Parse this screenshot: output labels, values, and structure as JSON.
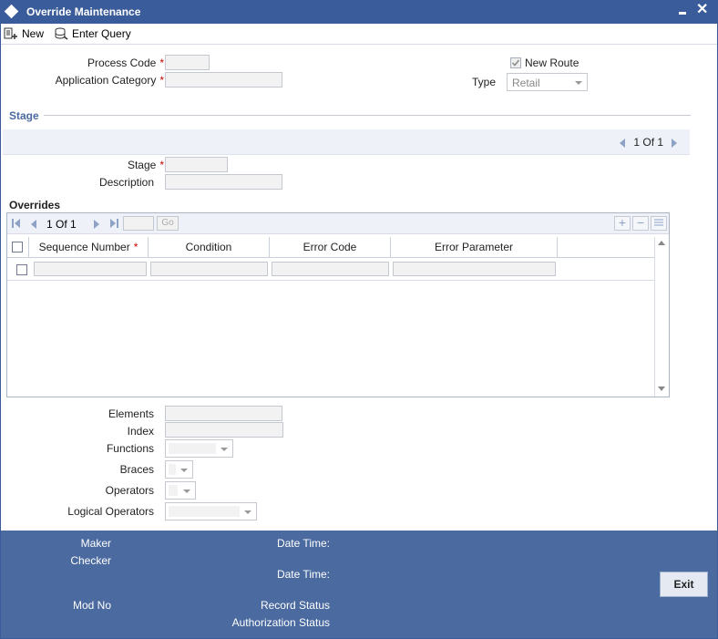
{
  "window": {
    "title": "Override Maintenance"
  },
  "toolbar": {
    "new_label": "New",
    "enter_query_label": "Enter Query"
  },
  "form": {
    "process_code_label": "Process Code",
    "application_category_label": "Application Category",
    "new_route_label": "New Route",
    "new_route_checked": true,
    "type_label": "Type",
    "type_value": "Retail",
    "required_mark": "*"
  },
  "stage_section": {
    "title": "Stage",
    "pager": {
      "current": "1",
      "of_label": "Of",
      "total": "1"
    },
    "stage_label": "Stage",
    "description_label": "Description"
  },
  "overrides": {
    "title": "Overrides",
    "pager": {
      "current": "1",
      "of_label": "Of",
      "total": "1",
      "go_label": "Go"
    },
    "columns": [
      "Sequence Number",
      "Condition",
      "Error Code",
      "Error Parameter"
    ]
  },
  "details": {
    "elements_label": "Elements",
    "index_label": "Index",
    "functions_label": "Functions",
    "braces_label": "Braces",
    "operators_label": "Operators",
    "logical_operators_label": "Logical Operators"
  },
  "footer": {
    "maker_label": "Maker",
    "checker_label": "Checker",
    "date_time_label": "Date Time:",
    "mod_no_label": "Mod No",
    "record_status_label": "Record Status",
    "authorization_status_label": "Authorization Status",
    "exit_label": "Exit"
  },
  "colors": {
    "header": "#3b5c9a",
    "footer": "#4a6aa0",
    "accent": "#4a6aa0",
    "required": "#cc0000"
  }
}
